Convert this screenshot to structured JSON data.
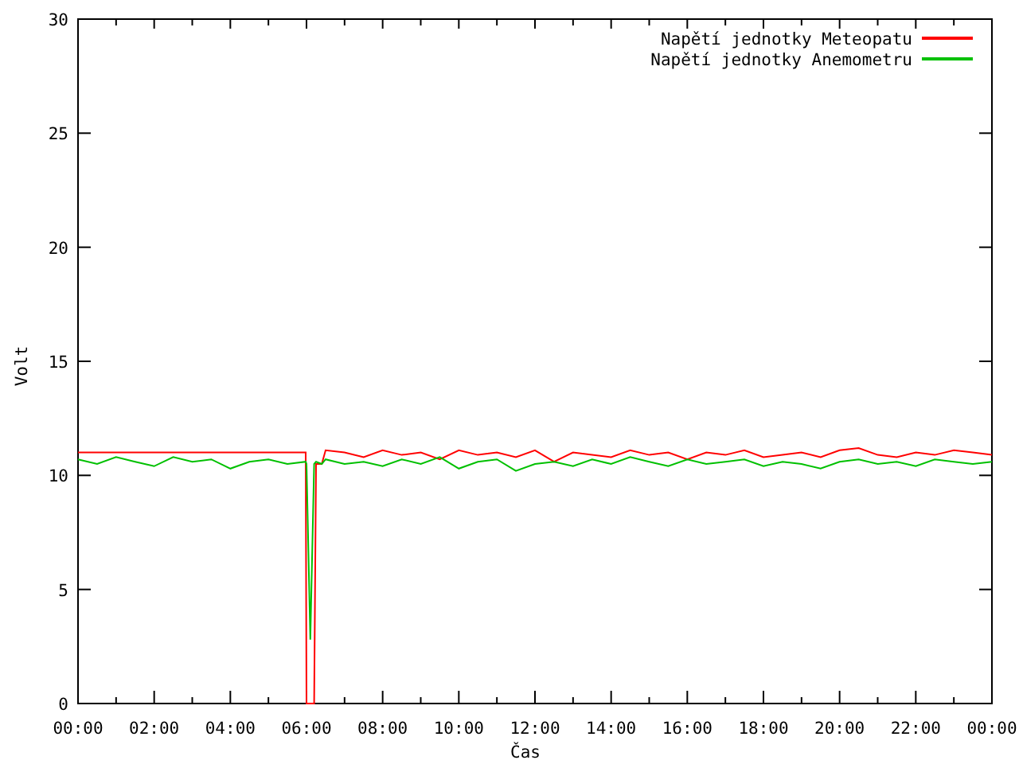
{
  "chart_data": {
    "type": "line",
    "xlabel": "Čas",
    "ylabel": "Volt",
    "x": [
      0,
      0.5,
      1,
      1.5,
      2,
      2.5,
      3,
      3.5,
      4,
      4.5,
      5,
      5.5,
      5.98,
      6.0,
      6.1,
      6.2,
      6.25,
      6.4,
      6.5,
      7,
      7.5,
      8,
      8.5,
      9,
      9.5,
      10,
      10.5,
      11,
      11.5,
      12,
      12.5,
      13,
      13.5,
      14,
      14.5,
      15,
      15.5,
      16,
      16.5,
      17,
      17.5,
      18,
      18.5,
      19,
      19.5,
      20,
      20.5,
      21,
      21.5,
      22,
      22.5,
      23,
      23.5,
      24
    ],
    "series": [
      {
        "name": "Napětí jednotky Meteopatu",
        "color": "#ff0000",
        "values": [
          11,
          11,
          11,
          11,
          11,
          11,
          11,
          11,
          11,
          11,
          11,
          11,
          11,
          0,
          0,
          0,
          10.5,
          10.5,
          11.1,
          11.0,
          10.8,
          11.1,
          10.9,
          11.0,
          10.7,
          11.1,
          10.9,
          11.0,
          10.8,
          11.1,
          10.6,
          11.0,
          10.9,
          10.8,
          11.1,
          10.9,
          11.0,
          10.7,
          11.0,
          10.9,
          11.1,
          10.8,
          10.9,
          11.0,
          10.8,
          11.1,
          11.2,
          10.9,
          10.8,
          11.0,
          10.9,
          11.1,
          11.0,
          10.9
        ]
      },
      {
        "name": "Napětí jednotky Anemometru",
        "color": "#00c000",
        "values": [
          10.7,
          10.5,
          10.8,
          10.6,
          10.4,
          10.8,
          10.6,
          10.7,
          10.3,
          10.6,
          10.7,
          10.5,
          10.6,
          10.5,
          2.8,
          10.5,
          10.6,
          10.5,
          10.7,
          10.5,
          10.6,
          10.4,
          10.7,
          10.5,
          10.8,
          10.3,
          10.6,
          10.7,
          10.2,
          10.5,
          10.6,
          10.4,
          10.7,
          10.5,
          10.8,
          10.6,
          10.4,
          10.7,
          10.5,
          10.6,
          10.7,
          10.4,
          10.6,
          10.5,
          10.3,
          10.6,
          10.7,
          10.5,
          10.6,
          10.4,
          10.7,
          10.6,
          10.5,
          10.6
        ]
      }
    ],
    "xlim": [
      0,
      24
    ],
    "ylim": [
      0,
      30
    ],
    "xticks": [
      {
        "value": 0,
        "label": "00:00"
      },
      {
        "value": 2,
        "label": "02:00"
      },
      {
        "value": 4,
        "label": "04:00"
      },
      {
        "value": 6,
        "label": "06:00"
      },
      {
        "value": 8,
        "label": "08:00"
      },
      {
        "value": 10,
        "label": "10:00"
      },
      {
        "value": 12,
        "label": "12:00"
      },
      {
        "value": 14,
        "label": "14:00"
      },
      {
        "value": 16,
        "label": "16:00"
      },
      {
        "value": 18,
        "label": "18:00"
      },
      {
        "value": 20,
        "label": "20:00"
      },
      {
        "value": 22,
        "label": "22:00"
      },
      {
        "value": 24,
        "label": "00:00"
      }
    ],
    "yticks": [
      0,
      5,
      10,
      15,
      20,
      25,
      30
    ],
    "legend": true
  }
}
